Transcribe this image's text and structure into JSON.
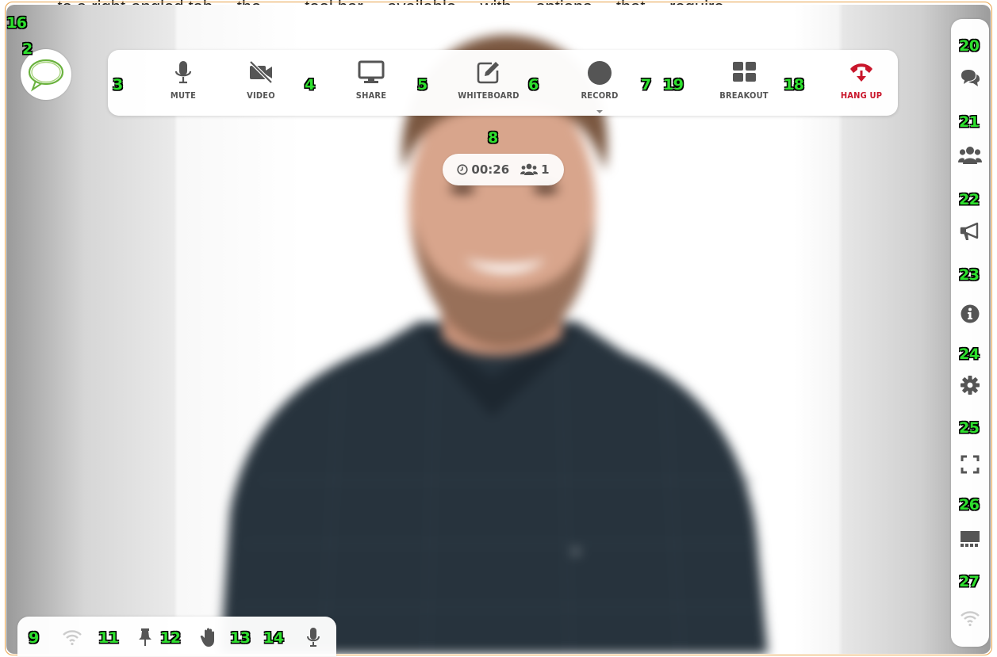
{
  "top_caption": "... to a right-angled tab ... the ... ... tool bar ... available ... with ... options ... that ... require ...",
  "toolbar": {
    "mute_label": "MUTE",
    "video_label": "VIDEO",
    "share_label": "SHARE",
    "whiteboard_label": "WHITEBOARD",
    "record_label": "RECORD",
    "breakout_label": "BREAKOUT",
    "hangup_label": "HANG UP"
  },
  "status": {
    "timer": "00:26",
    "participants": "1"
  },
  "marker_labels": {
    "m2": "2",
    "m3": "3",
    "m4": "4",
    "m5": "5",
    "m6": "6",
    "m7": "7",
    "m8": "8",
    "m9": "9",
    "m11": "11",
    "m12": "12",
    "m13": "13",
    "m14": "14",
    "m16": "16",
    "m18": "18",
    "m19": "19",
    "m20": "20",
    "m21": "21",
    "m22": "22",
    "m23": "23",
    "m24": "24",
    "m25": "25",
    "m26": "26",
    "m27": "27"
  },
  "icons": {
    "logo": "speech-bubble-logo-icon",
    "mute": "microphone-icon",
    "video": "video-off-icon",
    "share": "monitor-icon",
    "whiteboard": "edit-square-icon",
    "record": "record-circle-icon",
    "breakout": "grid-icon",
    "hangup": "phone-hangup-icon",
    "chat": "chat-icon",
    "participants": "users-icon",
    "announce": "megaphone-icon",
    "info": "info-icon",
    "settings": "gear-icon",
    "fullscreen": "fullscreen-icon",
    "layout": "layout-strip-icon",
    "connection": "wifi-icon",
    "pin": "pin-icon",
    "raise_hand": "hand-icon",
    "mic_status": "microphone-icon",
    "clock": "clock-icon"
  },
  "colors": {
    "accent_orange": "#e8a24a",
    "hangup_red": "#c9162b",
    "logo_green": "#6ab23d",
    "icon_gray": "#555555",
    "marker_green": "#2ee02e"
  }
}
